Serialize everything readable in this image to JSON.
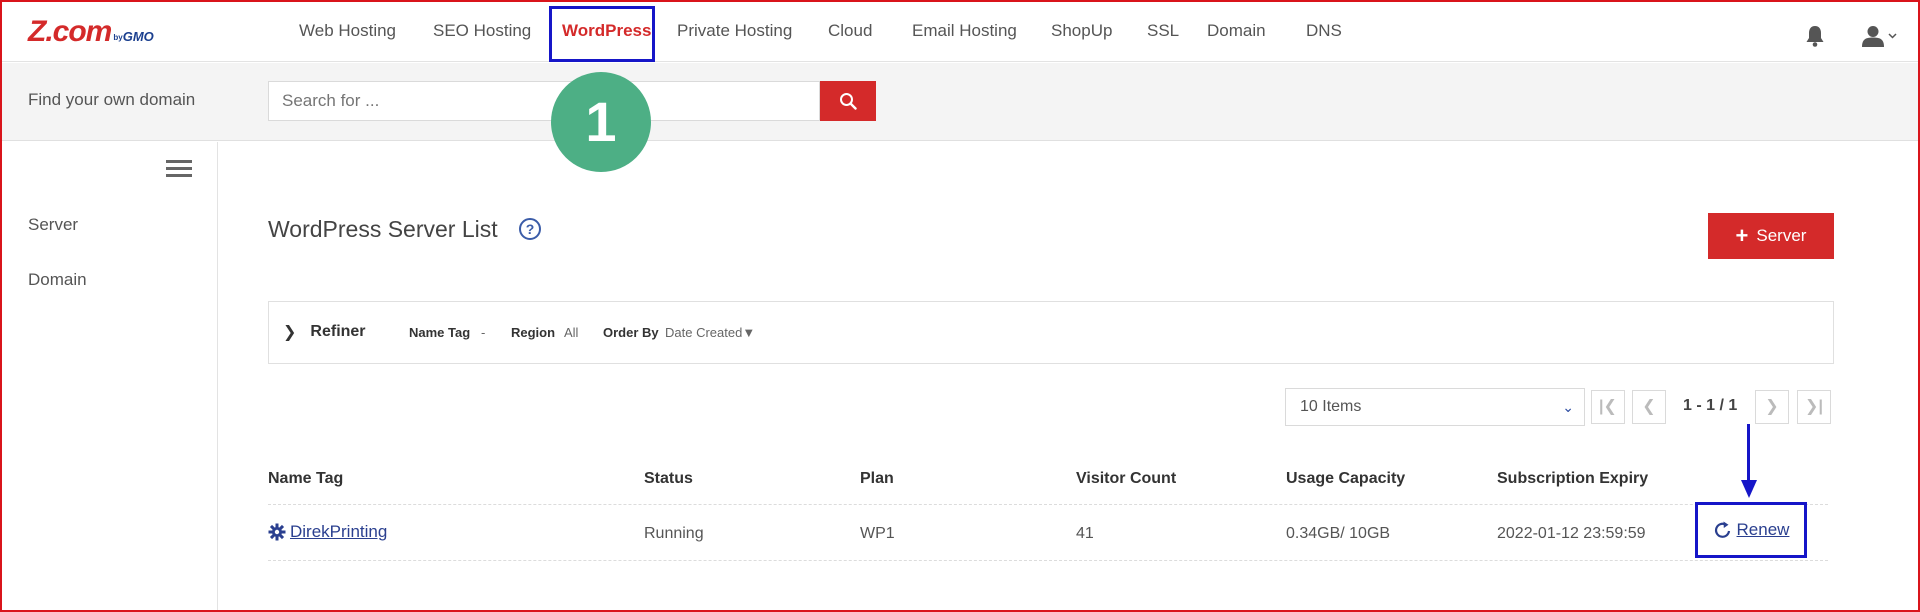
{
  "brand": {
    "name": "Z.com",
    "by": "by",
    "gmo": "GMO"
  },
  "nav": {
    "items": [
      {
        "label": "Web Hosting"
      },
      {
        "label": "SEO Hosting"
      },
      {
        "label": "WordPress",
        "active": true
      },
      {
        "label": "Private Hosting"
      },
      {
        "label": "Cloud"
      },
      {
        "label": "Email Hosting"
      },
      {
        "label": "ShopUp"
      },
      {
        "label": "SSL"
      },
      {
        "label": "Domain"
      },
      {
        "label": "DNS"
      }
    ],
    "icons": [
      "bell-icon",
      "user-icon",
      "chevron-down-icon"
    ]
  },
  "search": {
    "label": "Find your own domain",
    "placeholder": "Search for ..."
  },
  "annotation": {
    "step": "1"
  },
  "sidebar": {
    "items": [
      {
        "label": "Server"
      },
      {
        "label": "Domain"
      }
    ]
  },
  "main": {
    "title": "WordPress Server List",
    "add_button": "Server",
    "refiner": {
      "label": "Refiner",
      "name_tag_key": "Name Tag",
      "name_tag_value": "-",
      "region_key": "Region",
      "region_value": "All",
      "order_key": "Order By",
      "order_value": "Date Created▼"
    },
    "pagination": {
      "items_per_page": "10 Items",
      "range": "1 - 1 / 1"
    },
    "table": {
      "headers": [
        "Name Tag",
        "Status",
        "Plan",
        "Visitor Count",
        "Usage Capacity",
        "Subscription Expiry"
      ],
      "rows": [
        {
          "name": "DirekPrinting",
          "status": "Running",
          "plan": "WP1",
          "visitor_count": "41",
          "usage": "0.34GB/ 10GB",
          "expiry": "2022-01-12 23:59:59",
          "action": "Renew"
        }
      ]
    }
  },
  "colors": {
    "accent": "#d42a2a",
    "highlight": "#1616c8",
    "step": "#4daf85",
    "link": "#2a3f8f"
  }
}
